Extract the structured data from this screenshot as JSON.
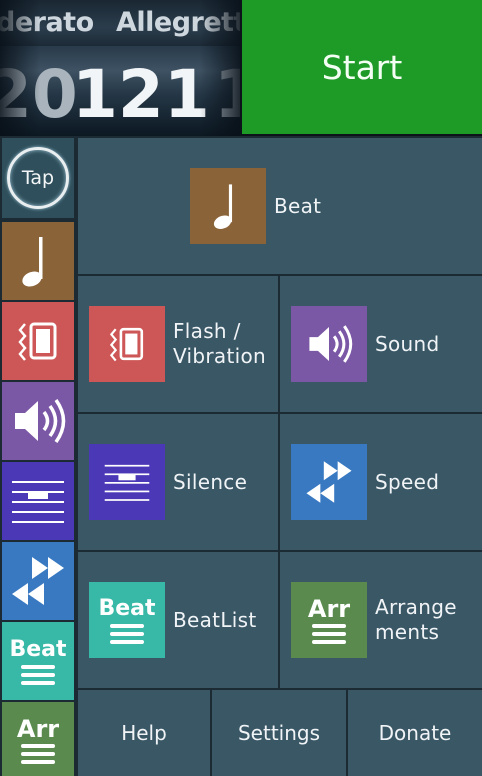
{
  "tempo": {
    "names": [
      "derato",
      "Allegrett"
    ],
    "current_bpm": "121",
    "prev_bpm": "20",
    "next_bpm": "1"
  },
  "start": {
    "label": "Start"
  },
  "tap": {
    "label": "Tap"
  },
  "tiles": {
    "beat": "Beat",
    "flash": "Flash / Vibration",
    "sound": "Sound",
    "silence": "Silence",
    "speed": "Speed",
    "beatlist": "BeatList",
    "arrangements": "Arrangements"
  },
  "icons": {
    "beat_text": "Beat",
    "arr_text": "Arr"
  },
  "bottom": {
    "help": "Help",
    "settings": "Settings",
    "donate": "Donate"
  },
  "colors": {
    "start": "#1e9a26",
    "beat": "#8a6338",
    "flash": "#cd5656",
    "sound": "#7b58a6",
    "silence": "#4a38b6",
    "speed": "#3979c1",
    "beatlist": "#38b8a6",
    "arrangements": "#5a8a4e",
    "tile": "#3a5766"
  }
}
